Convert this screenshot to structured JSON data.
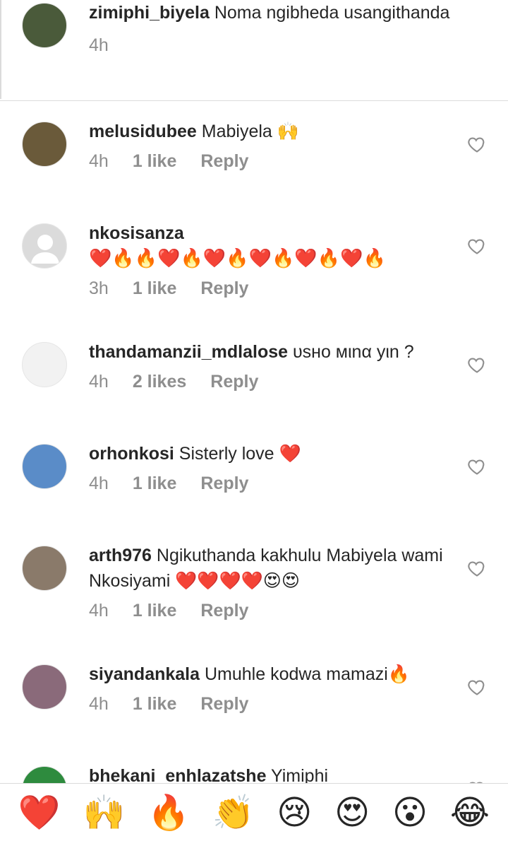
{
  "comments": [
    {
      "username": "zimiphi_biyela",
      "text": "Noma ngibheda usangithanda",
      "time": "4h",
      "likes": "",
      "reply": "",
      "avatar_color": "#4a5a3a"
    },
    {
      "username": "melusidubee",
      "text": "Mabiyela 🙌",
      "time": "4h",
      "likes": "1 like",
      "reply": "Reply",
      "avatar_color": "#6a5a3a"
    },
    {
      "username": "nkosisanza",
      "text": "❤️🔥🔥❤️🔥❤️🔥❤️🔥❤️🔥❤️🔥",
      "time": "3h",
      "likes": "1 like",
      "reply": "Reply",
      "avatar_color": "#dbdbdb"
    },
    {
      "username": "thandamanzii_mdlalose",
      "text": "υsнo мιnα yιn ?",
      "time": "4h",
      "likes": "2 likes",
      "reply": "Reply",
      "avatar_color": "#f2f2f2"
    },
    {
      "username": "orhonkosi",
      "text": "Sisterly love ❤️",
      "time": "4h",
      "likes": "1 like",
      "reply": "Reply",
      "avatar_color": "#5a8cc8"
    },
    {
      "username": "arth976",
      "text": "Ngikuthanda kakhulu Mabiyela wami Nkosiyami ❤️❤️❤️❤️😍😍",
      "time": "4h",
      "likes": "1 like",
      "reply": "Reply",
      "avatar_color": "#8a7a6a"
    },
    {
      "username": "siyandankala",
      "text": "Umuhle kodwa mamazi🔥",
      "time": "4h",
      "likes": "1 like",
      "reply": "Reply",
      "avatar_color": "#8a6a7a"
    },
    {
      "username": "bhekani_enhlazatshe",
      "text": "Yimiphi",
      "time": "",
      "likes": "",
      "reply": "",
      "avatar_color": "#2e8b3e"
    }
  ],
  "reactions": [
    "❤️",
    "🙌",
    "🔥",
    "👏",
    "😢",
    "😍",
    "😮",
    "😂"
  ],
  "colors": {
    "text": "#262626",
    "meta": "#8e8e8e",
    "divider": "#dbdbdb",
    "heart_outline": "#8e8e8e"
  },
  "icons": {
    "like": "heart-outline-icon"
  }
}
